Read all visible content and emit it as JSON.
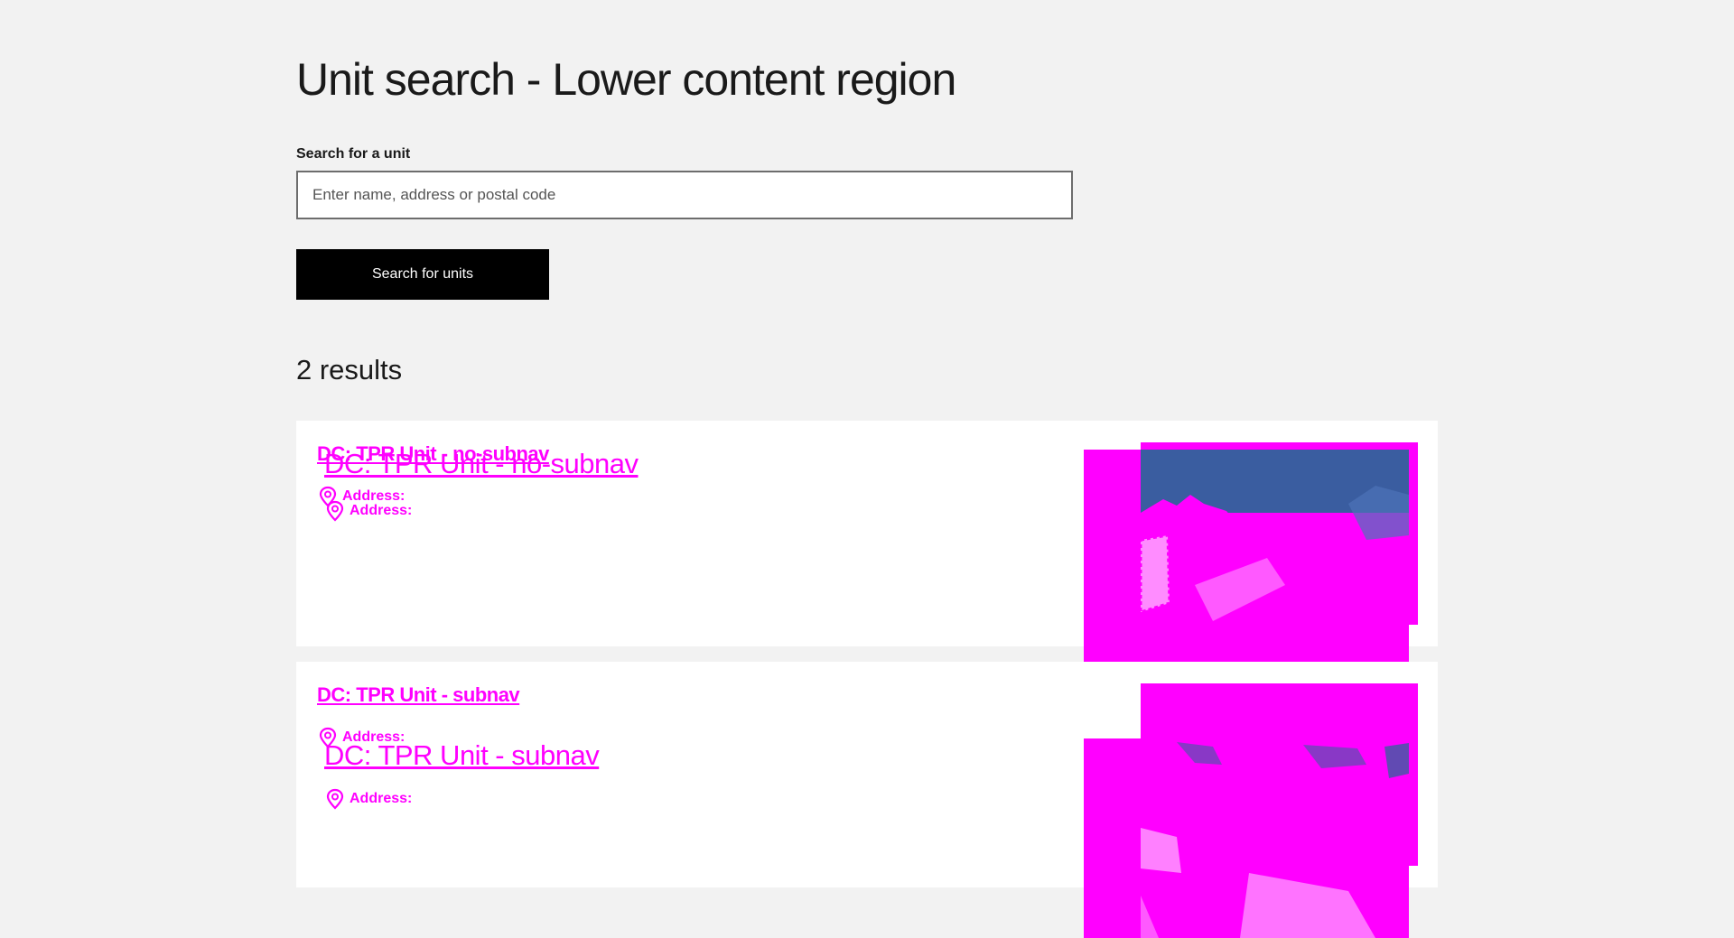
{
  "page": {
    "title": "Unit search - Lower content region"
  },
  "search": {
    "label": "Search for a unit",
    "placeholder": "Enter name, address or postal code",
    "value": "",
    "button_label": "Search for units"
  },
  "results": {
    "count_text": "2 results",
    "items": [
      {
        "name": "DC: TPR Unit - no-subnav",
        "address_label": "Address:"
      },
      {
        "name": "DC: TPR Unit - subnav",
        "address_label": "Address:"
      }
    ]
  },
  "colors": {
    "background": "#f2f2f2",
    "card": "#ffffff",
    "button": "#000000",
    "accent_magenta": "#ff00ff"
  },
  "icons": {
    "address": "location-pin-icon"
  }
}
